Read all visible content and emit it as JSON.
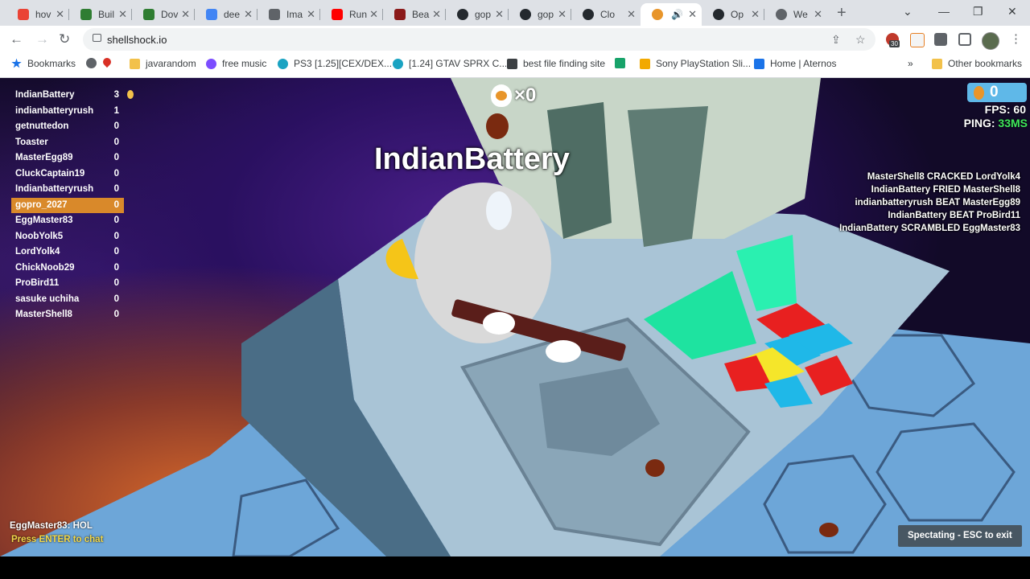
{
  "browser": {
    "tabs": [
      {
        "label": "hov",
        "color": "#ea4335"
      },
      {
        "label": "Buil",
        "color": "#2f7d32"
      },
      {
        "label": "Dov",
        "color": "#2f7d32"
      },
      {
        "label": "dee",
        "color": "#4285f4"
      },
      {
        "label": "Ima",
        "color": "#5f6368"
      },
      {
        "label": "Run",
        "color": "#ff0000"
      },
      {
        "label": "Bea",
        "color": "#8b1a1a"
      },
      {
        "label": "gop",
        "color": "#24292e"
      },
      {
        "label": "gop",
        "color": "#24292e"
      },
      {
        "label": "Clo",
        "color": "#24292e"
      },
      {
        "label": "",
        "color": "#e8952a"
      },
      {
        "label": "Op",
        "color": "#24292e"
      },
      {
        "label": "We",
        "color": "#5f6368"
      }
    ],
    "url": "shellshock.io",
    "extension_badge": "30",
    "bookmarks": [
      {
        "label": "Bookmarks",
        "color": "#1a73e8"
      },
      {
        "label": "",
        "color": "#5f6368"
      },
      {
        "label": "",
        "color": "#d93025"
      },
      {
        "label": "javarandom",
        "color": "#f2c14a"
      },
      {
        "label": "free music",
        "color": "#7c4dff"
      },
      {
        "label": "PS3 [1.25][CEX/DEX...",
        "color": "#1aa3c2"
      },
      {
        "label": "[1.24] GTAV SPRX C...",
        "color": "#1aa3c2"
      },
      {
        "label": "best file finding site",
        "color": "#3c4043"
      },
      {
        "label": "",
        "color": "#18a36a"
      },
      {
        "label": "Sony PlayStation Sli...",
        "color": "#f2a900"
      },
      {
        "label": "Home | Aternos",
        "color": "#1a73e8"
      },
      {
        "label": "Other bookmarks",
        "color": "#f2c14a"
      }
    ]
  },
  "game": {
    "kill_count": "×0",
    "spectating_player": "IndianBattery",
    "egg_count": "0",
    "fps_label": "FPS: 60",
    "ping_label": "PING: ",
    "ping_value": "33MS",
    "scoreboard": [
      {
        "name": "IndianBattery",
        "score": "3"
      },
      {
        "name": "indianbatteryrush",
        "score": "1"
      },
      {
        "name": "getnuttedon",
        "score": "0"
      },
      {
        "name": "Toaster",
        "score": "0"
      },
      {
        "name": "MasterEgg89",
        "score": "0"
      },
      {
        "name": "CluckCaptain19",
        "score": "0"
      },
      {
        "name": "Indianbatteryrush",
        "score": "0"
      },
      {
        "name": "gopro_2027",
        "score": "0"
      },
      {
        "name": "EggMaster83",
        "score": "0"
      },
      {
        "name": "NoobYolk5",
        "score": "0"
      },
      {
        "name": "LordYolk4",
        "score": "0"
      },
      {
        "name": "ChickNoob29",
        "score": "0"
      },
      {
        "name": "ProBird11",
        "score": "0"
      },
      {
        "name": "sasuke uchiha",
        "score": "0"
      },
      {
        "name": "MasterShell8",
        "score": "0"
      }
    ],
    "kill_feed": [
      "MasterShell8 CRACKED LordYolk4",
      "IndianBattery FRIED MasterShell8",
      "indianbatteryrush BEAT MasterEgg89",
      "IndianBattery BEAT ProBird11",
      "IndianBattery SCRAMBLED EggMaster83"
    ],
    "chat_message": "EggMaster83: HOL",
    "chat_hint": "Press ENTER to chat",
    "spectate_status": "Spectating - ESC to exit",
    "highlight_color": "#d9892a",
    "ping_color": "#3ee85a"
  }
}
